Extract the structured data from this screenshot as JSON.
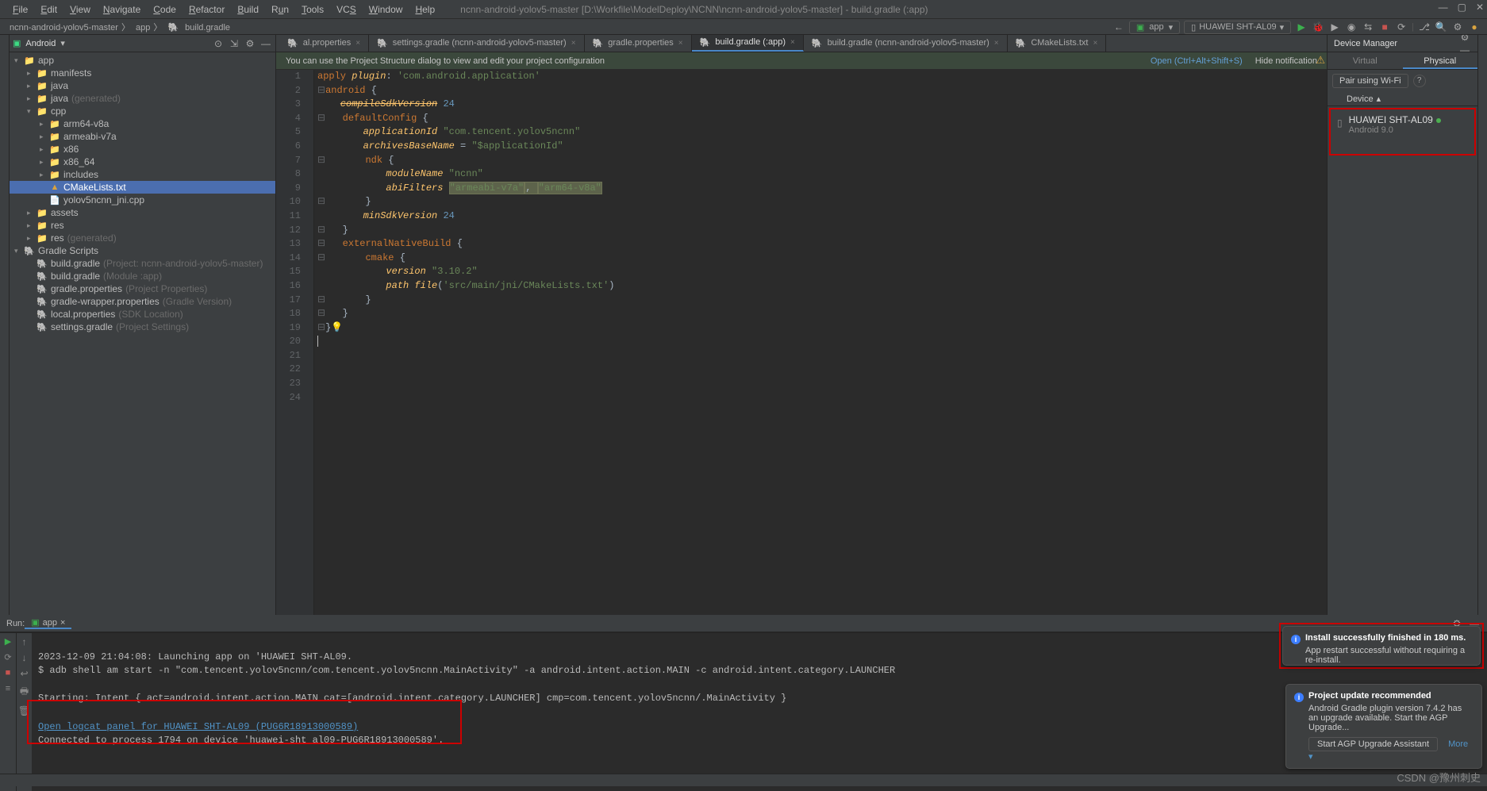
{
  "menu": {
    "file": "File",
    "edit": "Edit",
    "view": "View",
    "navigate": "Navigate",
    "code": "Code",
    "refactor": "Refactor",
    "build": "Build",
    "run": "Run",
    "tools": "Tools",
    "vcs": "VCS",
    "window": "Window",
    "help": "Help"
  },
  "title": "ncnn-android-yolov5-master [D:\\Workfile\\ModelDeploy\\NCNN\\ncnn-android-yolov5-master] - build.gradle (:app)",
  "breadcrumb": {
    "root": "ncnn-android-yolov5-master",
    "app": "app",
    "file": "build.gradle"
  },
  "toolbar": {
    "runConfig": "app",
    "device": "HUAWEI SHT-AL09"
  },
  "projectHeader": {
    "label": "Android"
  },
  "tree": [
    {
      "depth": 0,
      "chev": "▾",
      "icon": "📁",
      "text": "app",
      "color": "#c87a3e"
    },
    {
      "depth": 1,
      "chev": "▸",
      "icon": "📁",
      "text": "manifests"
    },
    {
      "depth": 1,
      "chev": "▸",
      "icon": "📁",
      "text": "java"
    },
    {
      "depth": 1,
      "chev": "▸",
      "icon": "📁",
      "text": "java",
      "muted": "(generated)"
    },
    {
      "depth": 1,
      "chev": "▾",
      "icon": "📁",
      "text": "cpp"
    },
    {
      "depth": 2,
      "chev": "▸",
      "icon": "📁",
      "text": "arm64-v8a"
    },
    {
      "depth": 2,
      "chev": "▸",
      "icon": "📁",
      "text": "armeabi-v7a"
    },
    {
      "depth": 2,
      "chev": "▸",
      "icon": "📁",
      "text": "x86"
    },
    {
      "depth": 2,
      "chev": "▸",
      "icon": "📁",
      "text": "x86_64"
    },
    {
      "depth": 2,
      "chev": "▸",
      "icon": "📁",
      "text": "includes"
    },
    {
      "depth": 2,
      "chev": "",
      "icon": "▲",
      "text": "CMakeLists.txt",
      "selected": true
    },
    {
      "depth": 2,
      "chev": "",
      "icon": "📄",
      "text": "yolov5ncnn_jni.cpp",
      "iconColor": "#5193c7"
    },
    {
      "depth": 1,
      "chev": "▸",
      "icon": "📁",
      "text": "assets"
    },
    {
      "depth": 1,
      "chev": "▸",
      "icon": "📁",
      "text": "res"
    },
    {
      "depth": 1,
      "chev": "▸",
      "icon": "📁",
      "text": "res",
      "muted": "(generated)"
    },
    {
      "depth": 0,
      "chev": "▾",
      "icon": "🐘",
      "text": "Gradle Scripts"
    },
    {
      "depth": 1,
      "chev": "",
      "icon": "🐘",
      "text": "build.gradle",
      "muted": "(Project: ncnn-android-yolov5-master)"
    },
    {
      "depth": 1,
      "chev": "",
      "icon": "🐘",
      "text": "build.gradle",
      "muted": "(Module :app)"
    },
    {
      "depth": 1,
      "chev": "",
      "icon": "🐘",
      "text": "gradle.properties",
      "muted": "(Project Properties)"
    },
    {
      "depth": 1,
      "chev": "",
      "icon": "🐘",
      "text": "gradle-wrapper.properties",
      "muted": "(Gradle Version)"
    },
    {
      "depth": 1,
      "chev": "",
      "icon": "🐘",
      "text": "local.properties",
      "muted": "(SDK Location)"
    },
    {
      "depth": 1,
      "chev": "",
      "icon": "🐘",
      "text": "settings.gradle",
      "muted": "(Project Settings)"
    }
  ],
  "tabs": [
    {
      "label": "al.properties"
    },
    {
      "label": "settings.gradle (ncnn-android-yolov5-master)"
    },
    {
      "label": "gradle.properties"
    },
    {
      "label": "build.gradle (:app)",
      "active": true
    },
    {
      "label": "build.gradle (ncnn-android-yolov5-master)"
    },
    {
      "label": "CMakeLists.txt"
    }
  ],
  "infobar": {
    "msg": "You can use the Project Structure dialog to view and edit your project configuration",
    "open": "Open (Ctrl+Alt+Shift+S)",
    "hide": "Hide notification"
  },
  "code": [
    "apply plugin: 'com.android.application'",
    "",
    "android {",
    "    compileSdkVersion 24",
    "",
    "    defaultConfig {",
    "        applicationId \"com.tencent.yolov5ncnn\"",
    "        archivesBaseName = \"$applicationId\"",
    "",
    "        ndk {",
    "            moduleName \"ncnn\"",
    "            abiFilters \"armeabi-v7a\", \"arm64-v8a\"",
    "        }",
    "        minSdkVersion 24",
    "    }",
    "",
    "    externalNativeBuild {",
    "        cmake {",
    "            version \"3.10.2\"",
    "            path file('src/main/jni/CMakeLists.txt')",
    "        }",
    "    }",
    "}",
    ""
  ],
  "deviceManager": {
    "title": "Device Manager",
    "tab1": "Virtual",
    "tab2": "Physical",
    "pair": "Pair using Wi-Fi",
    "colDevice": "Device",
    "name": "HUAWEI SHT-AL09",
    "sub": "Android 9.0"
  },
  "runTab": {
    "label": "Run:",
    "config": "app"
  },
  "console": {
    "l1": "2023-12-09 21:04:08: Launching app on 'HUAWEI SHT-AL09.",
    "l2": "$ adb shell am start -n \"com.tencent.yolov5ncnn/com.tencent.yolov5ncnn.MainActivity\" -a android.intent.action.MAIN -c android.intent.category.LAUNCHER",
    "l3": "Starting: Intent { act=android.intent.action.MAIN cat=[android.intent.category.LAUNCHER] cmp=com.tencent.yolov5ncnn/.MainActivity }",
    "l4": "Open logcat panel for HUAWEI SHT-AL09 (PUG6R18913000589)",
    "l5": "Connected to process 1794 on device 'huawei-sht_al09-PUG6R18913000589'."
  },
  "toast1": {
    "title": "Install successfully finished in 180 ms.",
    "body": "App restart successful without requiring a re-install."
  },
  "toast2": {
    "title": "Project update recommended",
    "body": "Android Gradle plugin version 7.4.2 has an upgrade available. Start the AGP Upgrade...",
    "btn": "Start AGP Upgrade Assistant",
    "more": "More ▾"
  },
  "watermark": "CSDN @豫州刺史"
}
